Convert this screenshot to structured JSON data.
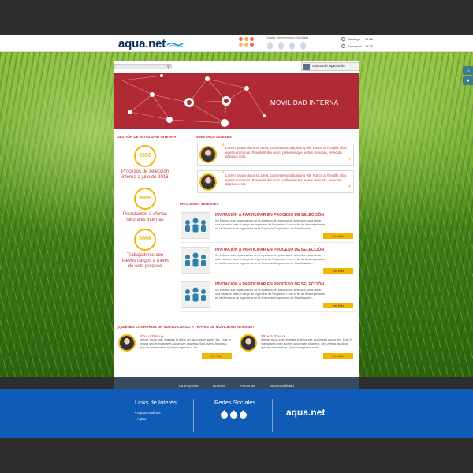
{
  "header": {
    "logo": "aqua.net",
    "status_title": "Estado Operaciones  Movilidad",
    "clocks": [
      {
        "city": "Santiago",
        "time": "17:26"
      },
      {
        "city": "Barcelona",
        "time": "17:26"
      }
    ]
  },
  "user": {
    "name": "operante operante"
  },
  "hero": {
    "title": "MOVILIDAD INTERNA"
  },
  "gestion": {
    "title": "GESTIÓN DE MOVILIDAD INTERNA",
    "stats": [
      {
        "value": "9999",
        "label": "Procesos de selección interna a julio de 2016"
      },
      {
        "value": "9999",
        "label": "Postulantes a ofertas laborales internas"
      },
      {
        "value": "9999",
        "label": "Trabajadores con nuevos cargos a través de este proceso"
      }
    ]
  },
  "leaders": {
    "title": "NUESTROS LÍDERES",
    "items": [
      {
        "text": "Lorem ipsum dolor sit amet, consectetur adipiscing elit. Fusce at fringilla nibh, eget rutrum nisi. Praesent dui nunc, pellentesque lectus vehicula, vehicula dapibus erat."
      },
      {
        "text": "Lorem ipsum dolor sit amet, consectetur adipiscing elit. Fusce at fringilla nibh, eget rutrum nisi. Praesent dui nunc, pellentesque lectus vehicula, vehicula dapibus erat."
      }
    ]
  },
  "procesos": {
    "title": "PROCESOS VIGENTES",
    "items": [
      {
        "title": "INVITACIÓN A PARTICIPAR EN PROCESO DE SELECCIÓN",
        "text": "Se informa a la organización de la apertura del proceso de selección para llenar una vacante para el cargo de Ingeniero de Proyectos I con el fin de desempeñarse en la Gerencia de Ingeniería de la Gerencia Corporativa de Planificación...",
        "button": "Ver Más"
      },
      {
        "title": "INVITACIÓN A PARTICIPAR EN PROCESO DE SELECCIÓN",
        "text": "Se informa a la organización de la apertura del proceso de selección para llenar una vacante para el cargo de Ingeniero de Proyectos I con el fin de desempeñarse en la Gerencia de Ingeniería de la Gerencia Corporativa de Planificación...",
        "button": "Ver Más"
      },
      {
        "title": "INVITACIÓN A PARTICIPAR EN PROCESO DE SELECCIÓN",
        "text": "Se informa a la organización de la apertura del proceso de selección para llenar una vacante para el cargo de Ingeniero de Proyectos I con el fin de desempeñarse en la Gerencia de Ingeniería de la Gerencia Corporativa de Planificación...",
        "button": "Ver Más"
      }
    ]
  },
  "quienes": {
    "title": "¿QUIÉNES LOGRARON UN NUEVO CARGO A TRAVÉS DE MOVILIDAD INTERNA?",
    "items": [
      {
        "title": "TÍTULO TÍTULO",
        "text": "Integer lacus erat, egestas in tellus vel, accumsan auctor leo. Duis et massa sed enim laoreet accumsan pharetra. Sed viverra faucibus quis leo elementum. Quisque eget lacus leo...",
        "button": "Ver Más"
      },
      {
        "title": "TÍTULO TÍTULO",
        "text": "Integer lacus erat, egestas in tellus vel, accumsan auctor leo. Duis et massa sed enim laoreet accumsan pharetra. Sed viverra faucibus quis leo elementum. Quisque eget lacus leo...",
        "button": "Ver Más"
      }
    ]
  },
  "nav": [
    "La Empresa",
    "Noticias",
    "Personas",
    "Sustentabilidad"
  ],
  "footer": {
    "links_title": "Links de Interés",
    "links": [
      "Aguas Andinas",
      "Agbar"
    ],
    "social_title": "Redes Sociales",
    "logo": "aqua.net"
  },
  "colors": {
    "accent_red": "#b02a35",
    "accent_yellow": "#f2b705",
    "footer_blue": "#0f5bb5",
    "nav_dark": "#3a4a61"
  }
}
